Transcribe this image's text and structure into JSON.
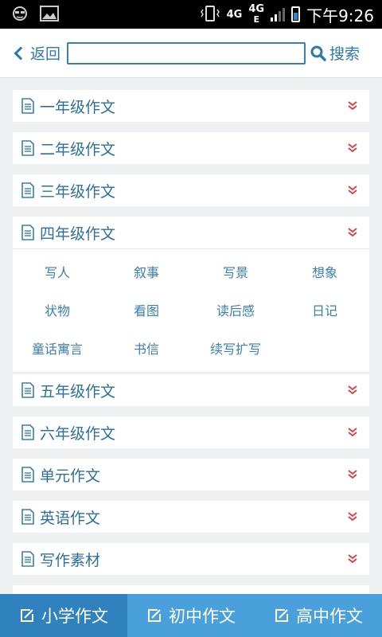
{
  "status_bar": {
    "net1": "4G",
    "net2": "4G",
    "net2_sub": "E",
    "time": "下午9:26"
  },
  "header": {
    "back_label": "返回",
    "search_value": "",
    "search_label": "搜索"
  },
  "categories": [
    {
      "label": "一年级作文"
    },
    {
      "label": "二年级作文"
    },
    {
      "label": "三年级作文"
    },
    {
      "label": "四年级作文",
      "expanded": true,
      "items": [
        "写人",
        "叙事",
        "写景",
        "想象",
        "状物",
        "看图",
        "读后感",
        "日记",
        "童话寓言",
        "书信",
        "续写扩写"
      ]
    },
    {
      "label": "五年级作文"
    },
    {
      "label": "六年级作文"
    },
    {
      "label": "单元作文"
    },
    {
      "label": "英语作文"
    },
    {
      "label": "写作素材"
    }
  ],
  "tabs": [
    {
      "label": "小学作文",
      "active": true
    },
    {
      "label": "初中作文",
      "active": false
    },
    {
      "label": "高中作文",
      "active": false
    }
  ],
  "colors": {
    "accent": "#3a7fae",
    "chevron": "#d9434b",
    "tabbar": "#4aa0db",
    "tab_active": "#2f82bd"
  }
}
